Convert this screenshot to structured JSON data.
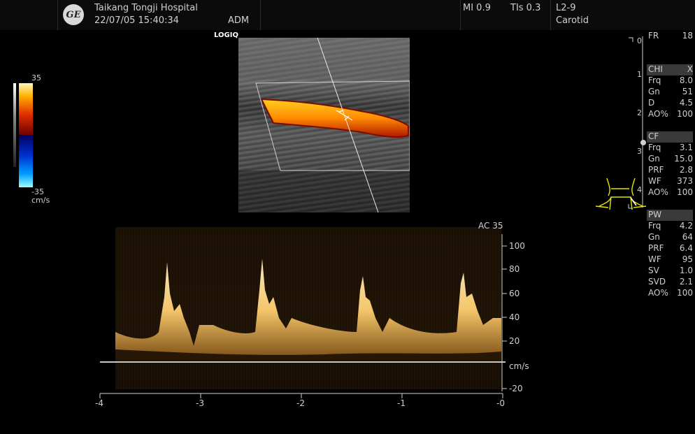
{
  "header": {
    "logo_text": "GE",
    "hospital": "Taikang Tongji Hospital",
    "datetime": "22/07/05 15:40:34",
    "operator": "ADM",
    "mi": "MI 0.9",
    "tis": "TIs 0.3",
    "probe": "L2-9",
    "preset": "Carotid"
  },
  "brand": "LOGIQ",
  "color_scale": {
    "max": "35",
    "min": "-35",
    "unit": "cm/s"
  },
  "depth_scale": [
    "0",
    "1",
    "2",
    "3",
    "4"
  ],
  "right_panel": {
    "fr": {
      "label": "FR",
      "value": "18"
    },
    "chi": {
      "title": "CHI",
      "title_value": "X",
      "rows": [
        {
          "label": "Frq",
          "value": "8.0"
        },
        {
          "label": "Gn",
          "value": "51"
        },
        {
          "label": "D",
          "value": "4.5"
        },
        {
          "label": "AO%",
          "value": "100"
        }
      ]
    },
    "cf": {
      "title": "CF",
      "rows": [
        {
          "label": "Frq",
          "value": "3.1"
        },
        {
          "label": "Gn",
          "value": "15.0"
        },
        {
          "label": "PRF",
          "value": "2.8"
        },
        {
          "label": "WF",
          "value": "373"
        },
        {
          "label": "AO%",
          "value": "100"
        }
      ]
    },
    "pw": {
      "title": "PW",
      "rows": [
        {
          "label": "Frq",
          "value": "4.2"
        },
        {
          "label": "Gn",
          "value": "64"
        },
        {
          "label": "PRF",
          "value": "6.4"
        },
        {
          "label": "WF",
          "value": "95"
        },
        {
          "label": "SV",
          "value": "1.0"
        },
        {
          "label": "SVD",
          "value": "2.1"
        },
        {
          "label": "AO%",
          "value": "100"
        }
      ]
    }
  },
  "doppler": {
    "ac_label": "AC 35",
    "velocity_unit": "cm/s",
    "velocity_ticks": [
      "100",
      "80",
      "60",
      "40",
      "20",
      "-20"
    ],
    "time_ticks": [
      "-4",
      "-3",
      "-2",
      "-1",
      "-0"
    ]
  },
  "colors": {
    "trace": "#ffd27a",
    "color_flow": "#ff8a00",
    "bodymark": "#e6e600"
  }
}
